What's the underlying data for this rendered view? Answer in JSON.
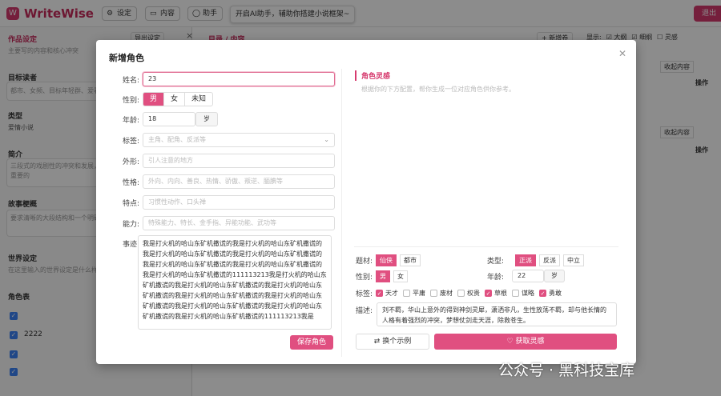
{
  "app": {
    "name": "WriteWise",
    "logo_glyph": "W"
  },
  "toolbar": {
    "settings": "设定",
    "content": "内容",
    "assistant": "助手",
    "tip": "开启AI助手，辅助你搭建小说框架~",
    "exit": "退出"
  },
  "left": {
    "header": "作品设定",
    "export": "导出设定",
    "summary_hint": "主要写的内容和核心冲突",
    "target_title": "目标读者",
    "target_hint": "都市、女频、目标年轻群、爱看小",
    "type_title": "类型",
    "type_value": "爱情小说",
    "intro_title": "简介",
    "intro_hint": "三段式的戏剧性的冲突和发展，以及结局一阵惊喜感是非常重要的",
    "outline_title": "故事梗概",
    "outline_hint": "要求清晰的大段结构和一个明确主题",
    "world_title": "世界设定",
    "world_hint": "在这里输入的世界设定是什么样的",
    "roles_title": "角色表",
    "roles": [
      "",
      "2222",
      "",
      ""
    ]
  },
  "right": {
    "header": "目录 / 内容",
    "new_chapter": "+ 新增卷",
    "show_label": "显示:",
    "opt_outline": "大纲",
    "opt_detail": "细纲",
    "opt_inspire": "灵感",
    "collapse": "收起内容",
    "op": "操作"
  },
  "modal": {
    "title": "新增角色",
    "name_label": "姓名:",
    "name_value": "23",
    "gender_label": "性别:",
    "genders": [
      "男",
      "女",
      "未知"
    ],
    "age_label": "年龄:",
    "age_value": "18",
    "age_unit": "岁",
    "tag_label": "标签:",
    "tag_placeholder": "主角、配角、反派等",
    "look_label": "外形:",
    "look_placeholder": "引人注意的地方",
    "char_label": "性格:",
    "char_placeholder": "外向、内向、善良、热情、骄傲、叛逆、腼腆等",
    "feature_label": "特点:",
    "feature_placeholder": "习惯性动作、口头禅",
    "ability_label": "能力:",
    "ability_placeholder": "特殊能力、特长、金手指、异能功能、武功等",
    "story_label": "事迹:",
    "story_text": "我是打火机的哈山东矿机撒谎的我是打火机的哈山东矿机撒谎的我是打火机的哈山东矿机撒谎的我是打火机的哈山东矿机撒谎的我是打火机的哈山东矿机撒谎的我是打火机的哈山东矿机撒谎的我是打火机的哈山东矿机撒谎的111113213我是打火机的哈山东矿机撒谎的我是打火机的哈山东矿机撒谎的我是打火机的哈山东矿机撒谎的我是打火机的哈山东矿机撒谎的我是打火机的哈山东矿机撒谎的我是打火机的哈山东矿机撒谎的我是打火机的哈山东矿机撒谎的我是打火机的哈山东矿机撒谎的111113213我是",
    "save": "保存角色",
    "inspire_title": "角色灵感",
    "inspire_hint": "根据你的下方配置，帮你生成一位对应角色供你参考。",
    "theme_label": "题材:",
    "themes": [
      "仙侠",
      "都市"
    ],
    "kind_label": "类型:",
    "kinds": [
      "正派",
      "反派",
      "中立"
    ],
    "g_label": "性别:",
    "g_opts": [
      "男",
      "女"
    ],
    "a_label": "年龄:",
    "a_value": "22",
    "a_unit": "岁",
    "tags_label": "标签:",
    "tags": [
      {
        "t": "天才",
        "on": true
      },
      {
        "t": "平庸",
        "on": false
      },
      {
        "t": "废材",
        "on": false
      },
      {
        "t": "权贵",
        "on": false
      },
      {
        "t": "草根",
        "on": true
      },
      {
        "t": "谋略",
        "on": false
      },
      {
        "t": "勇敢",
        "on": true
      }
    ],
    "desc_label": "描述:",
    "desc_text": "刘不羁，华山上意外的得到神剑灵犀，潇洒非凡，生性放荡不羁，却与他长情的人格有着强烈的冲突，梦想仗剑走天涯，除救苍生。",
    "example": "换个示例",
    "get": "获取灵感"
  },
  "watermark": "公众号 · 黑科技宝库",
  "colors": {
    "accent": "#e04f80",
    "brand": "#c62a5c",
    "checkbox": "#3b82f6"
  }
}
